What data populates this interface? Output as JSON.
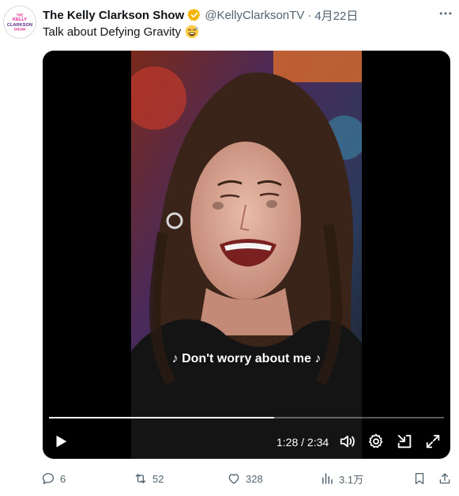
{
  "tweet": {
    "author_name": "The Kelly Clarkson Show",
    "handle": "@KellyClarksonTV",
    "separator": "·",
    "date": "4月22日",
    "text": "Talk about Defying Gravity",
    "avatar_text": [
      "THE",
      "KELLY",
      "CLARKSON",
      "SHOW"
    ]
  },
  "video": {
    "caption": "♪ Don't worry about me ♪",
    "time": "1:28 / 2:34",
    "progress": 0.57
  },
  "actions": {
    "replies": "6",
    "retweets": "52",
    "likes": "328",
    "views": "3.1万"
  },
  "colors": {
    "verified": "#f4b400",
    "brand_pink": "#e0218a",
    "brand_purple": "#5b2a86",
    "muted": "#536471"
  }
}
